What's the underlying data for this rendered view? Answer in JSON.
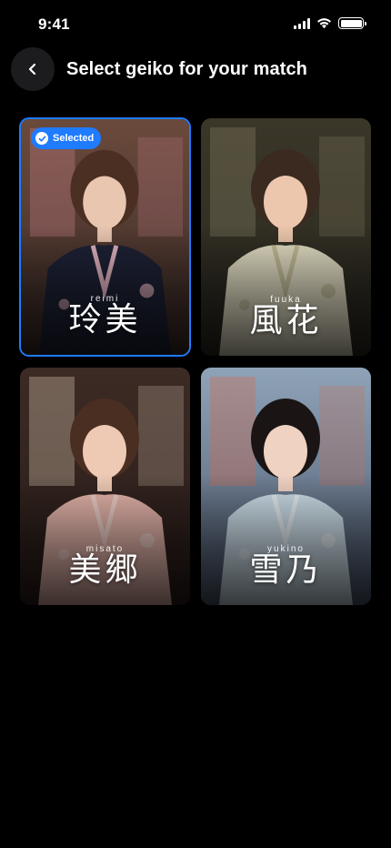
{
  "status_bar": {
    "time": "9:41"
  },
  "header": {
    "title": "Select geiko for your match"
  },
  "selected_badge_label": "Selected",
  "cards": [
    {
      "romaji": "reimi",
      "kanji": "玲美",
      "selected": true,
      "colors": {
        "bg_top": "#6a4a3c",
        "bg_bottom": "#3a2a26",
        "accent": "#c9808a",
        "kimono": "#1e2236",
        "kimono_accent": "#e8b7c4",
        "hair": "#4a2f22",
        "skin": "#e8c6b0"
      }
    },
    {
      "romaji": "fuuka",
      "kanji": "風花",
      "selected": false,
      "colors": {
        "bg_top": "#3a3628",
        "bg_bottom": "#2a2820",
        "accent": "#8a8566",
        "kimono": "#e7e2c8",
        "kimono_accent": "#c9c19c",
        "hair": "#3a2a20",
        "skin": "#ecc7ad"
      }
    },
    {
      "romaji": "misato",
      "kanji": "美郷",
      "selected": false,
      "colors": {
        "bg_top": "#3c2a24",
        "bg_bottom": "#2a1d1a",
        "accent": "#d9c9b3",
        "kimono": "#e8b7ad",
        "kimono_accent": "#f1d2cb",
        "hair": "#4a2e22",
        "skin": "#eecab4"
      }
    },
    {
      "romaji": "yukino",
      "kanji": "雪乃",
      "selected": false,
      "colors": {
        "bg_top": "#8fa3b8",
        "bg_bottom": "#4a566a",
        "accent": "#d46a4a",
        "kimono": "#cfe1ec",
        "kimono_accent": "#e9f1f6",
        "hair": "#1a1514",
        "skin": "#f0d2c2"
      }
    }
  ]
}
